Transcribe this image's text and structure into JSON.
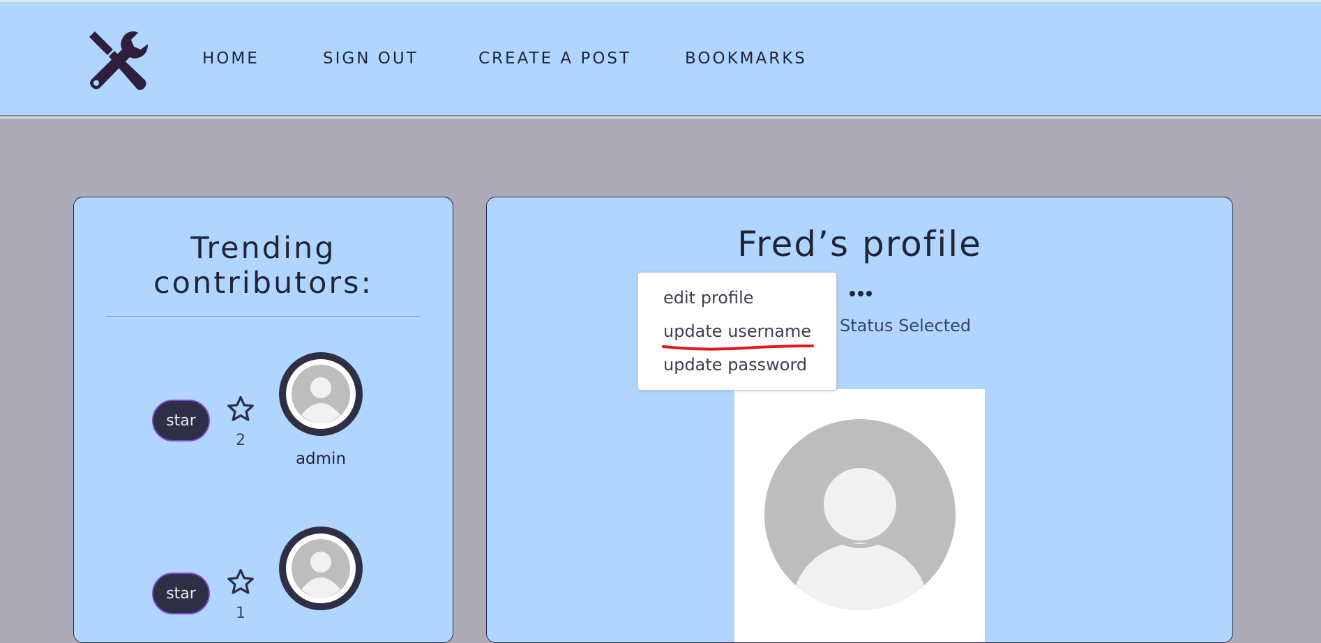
{
  "nav": {
    "home": "HOME",
    "sign_out": "SIGN OUT",
    "create_post": "CREATE A POST",
    "bookmarks": "BOOKMARKS"
  },
  "logo": {
    "icon": "tools-icon"
  },
  "trending": {
    "title_line1": "Trending",
    "title_line2": "contributors:",
    "contributors": [
      {
        "star_label": "star",
        "star_count": "2",
        "name": "admin"
      },
      {
        "star_label": "star",
        "star_count": "1",
        "name": ""
      }
    ]
  },
  "profile": {
    "title": "Fred’s profile",
    "status": "Status Selected",
    "menu": {
      "items": [
        "edit profile",
        "update username",
        "update password"
      ],
      "highlighted": "update username",
      "highlight_color": "#e0191c"
    }
  },
  "colors": {
    "header_bg": "#b0d6ff",
    "page_bg": "#acaab4",
    "card_bg": "#b0d6ff",
    "button_bg": "#2e2f45",
    "button_border": "#7d4bd1",
    "text_dark": "#1f2537"
  }
}
